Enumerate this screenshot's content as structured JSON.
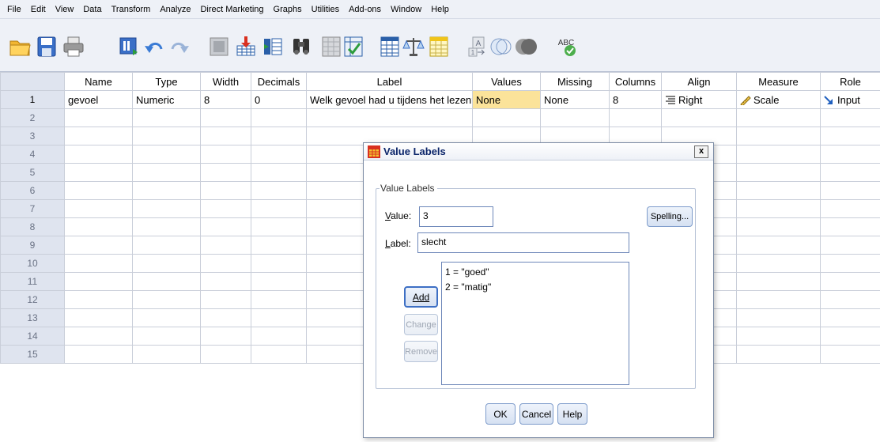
{
  "menu": [
    "File",
    "Edit",
    "View",
    "Data",
    "Transform",
    "Analyze",
    "Direct Marketing",
    "Graphs",
    "Utilities",
    "Add-ons",
    "Window",
    "Help"
  ],
  "toolbar": {
    "icons": [
      "open-folder-icon",
      "save-icon",
      "print-icon",
      "recall-dialog-icon",
      "undo-icon",
      "redo-icon",
      "goto-case-icon",
      "goto-variable-icon",
      "variables-icon",
      "find-icon",
      "insert-cases-icon",
      "insert-variable-icon",
      "split-file-icon",
      "weight-cases-icon",
      "select-cases-icon",
      "value-labels-icon",
      "use-sets-icon",
      "show-all-variables-icon",
      "spell-check-icon"
    ],
    "spelling_badge": "ABC"
  },
  "grid": {
    "columns": [
      "Name",
      "Type",
      "Width",
      "Decimals",
      "Label",
      "Values",
      "Missing",
      "Columns",
      "Align",
      "Measure",
      "Role"
    ],
    "rows": [
      {
        "num": "1",
        "name": "gevoel",
        "type": "Numeric",
        "width": "8",
        "decimals": "0",
        "label": "Welk gevoel had u tijdens het lezen?",
        "values": "None",
        "missing": "None",
        "columns": "8",
        "align": "Right",
        "measure": "Scale",
        "role": "Input"
      }
    ],
    "empty_row_numbers": [
      "2",
      "3",
      "4",
      "5",
      "6",
      "7",
      "8",
      "9",
      "10",
      "11",
      "12",
      "13",
      "14",
      "15"
    ]
  },
  "dialog": {
    "title": "Value Labels",
    "close": "x",
    "group_legend": "Value Labels",
    "value_label": "Value:",
    "value": "3",
    "label_label": "Label:",
    "label_value": "slecht",
    "spelling_button": "Spelling...",
    "add_button": "Add",
    "change_button": "Change",
    "remove_button": "Remove",
    "list_items": [
      "1 = \"goed\"",
      "2 = \"matig\""
    ],
    "ok_button": "OK",
    "cancel_button": "Cancel",
    "help_button": "Help"
  },
  "colors": {
    "highlight_cell": "#fbe39a",
    "menubar_bg": "#eef1f7",
    "rownum_bg": "#dfe4ef",
    "dialog_title_text": "#0a2469",
    "role_arrow": "#1f5fbf"
  }
}
